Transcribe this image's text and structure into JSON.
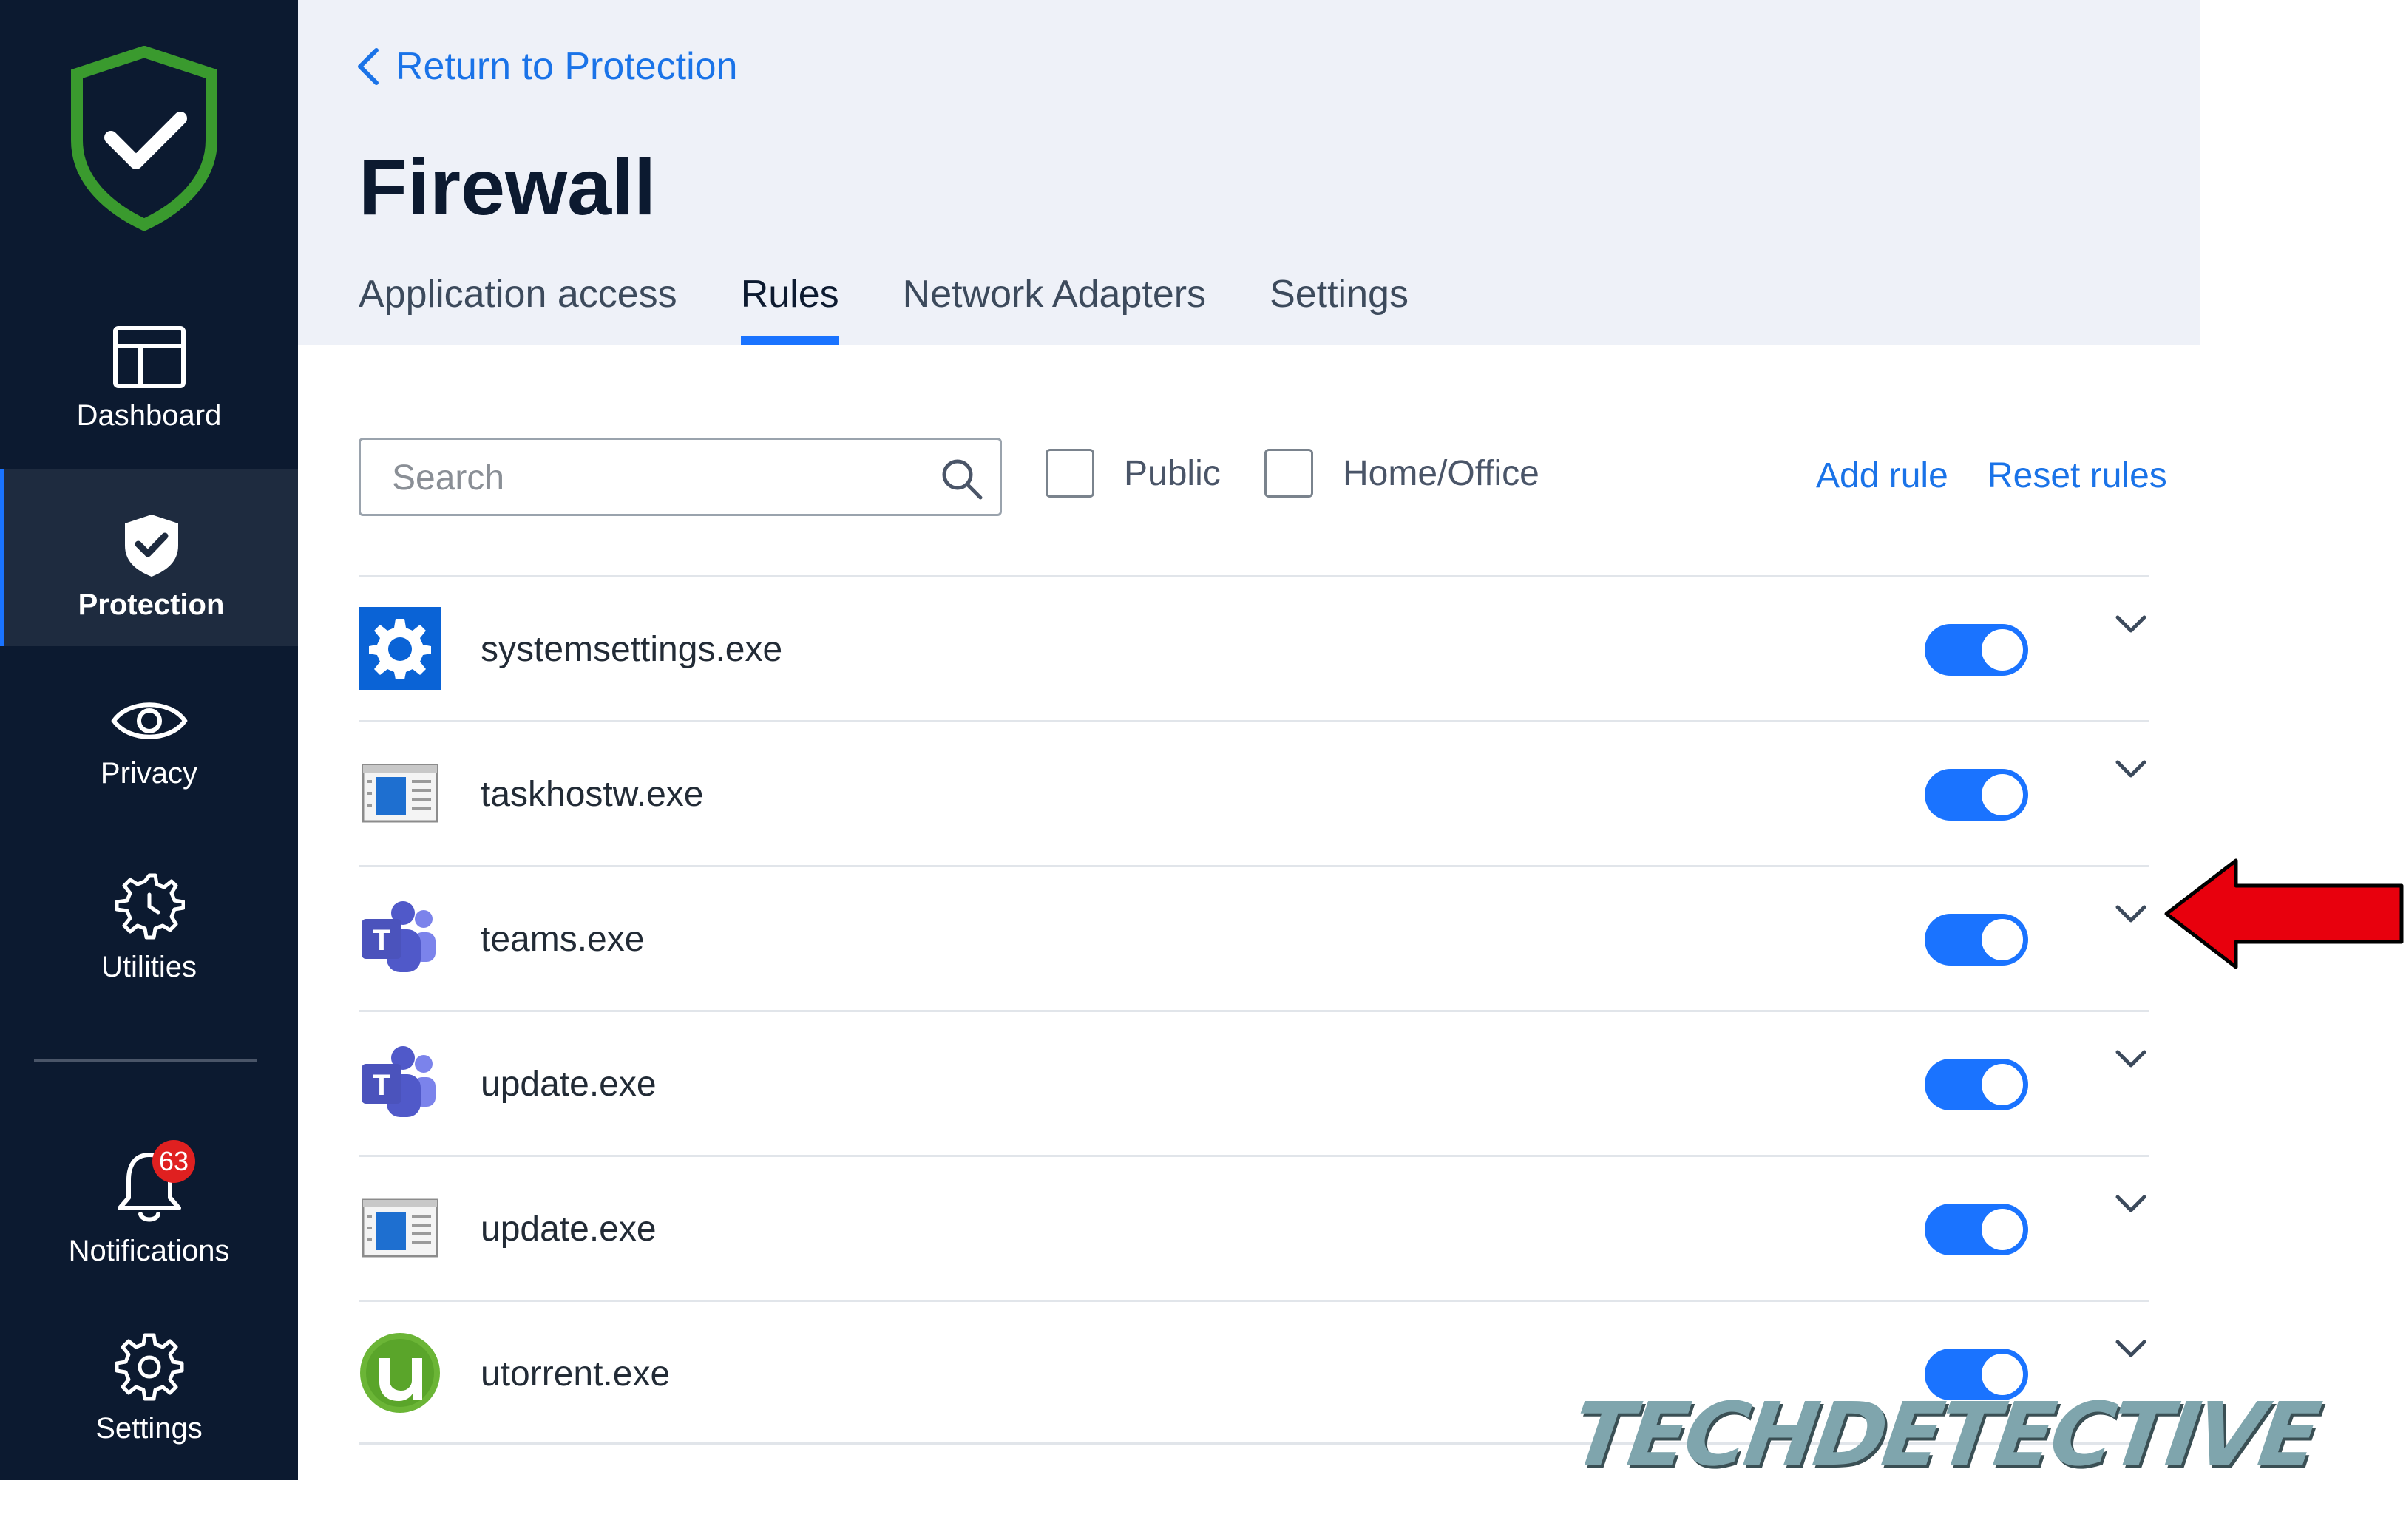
{
  "sidebar": {
    "items": [
      {
        "id": "dashboard",
        "label": "Dashboard",
        "icon": "layout-icon",
        "active": false
      },
      {
        "id": "protection",
        "label": "Protection",
        "icon": "shield-check-icon",
        "active": true
      },
      {
        "id": "privacy",
        "label": "Privacy",
        "icon": "eye-icon",
        "active": false
      },
      {
        "id": "utilities",
        "label": "Utilities",
        "icon": "gear-clock-icon",
        "active": false
      },
      {
        "id": "notifications",
        "label": "Notifications",
        "icon": "bell-icon",
        "active": false,
        "badge": "63"
      },
      {
        "id": "settings",
        "label": "Settings",
        "icon": "gear-icon",
        "active": false
      }
    ]
  },
  "header": {
    "back_label": "Return to Protection",
    "title": "Firewall",
    "tabs": [
      {
        "label": "Application access",
        "active": false
      },
      {
        "label": "Rules",
        "active": true
      },
      {
        "label": "Network Adapters",
        "active": false
      },
      {
        "label": "Settings",
        "active": false
      }
    ]
  },
  "toolbar": {
    "search_placeholder": "Search",
    "search_value": "",
    "filters": [
      {
        "label": "Public",
        "checked": false
      },
      {
        "label": "Home/Office",
        "checked": false
      }
    ],
    "add_rule_label": "Add rule",
    "reset_rules_label": "Reset rules"
  },
  "rules": [
    {
      "name": "systemsettings.exe",
      "icon": "settings-gear-app-icon",
      "enabled": true
    },
    {
      "name": "taskhostw.exe",
      "icon": "window-app-icon",
      "enabled": true
    },
    {
      "name": "teams.exe",
      "icon": "teams-icon",
      "enabled": true
    },
    {
      "name": "update.exe",
      "icon": "teams-icon",
      "enabled": true
    },
    {
      "name": "update.exe",
      "icon": "window-app-icon",
      "enabled": true
    },
    {
      "name": "utorrent.exe",
      "icon": "utorrent-icon",
      "enabled": true
    }
  ],
  "annotation": {
    "arrow_color": "#e8000d",
    "points_to": "teams.exe expand chevron"
  },
  "watermark": {
    "text": "TECHDETECTIVE"
  },
  "colors": {
    "sidebar_bg": "#0c1a30",
    "sidebar_active_bg": "#1e2b3f",
    "header_bg": "#eef1f8",
    "accent": "#1a73ff",
    "link": "#1a73e8",
    "shield_green": "#3a9a2e",
    "badge_red": "#e02020"
  }
}
